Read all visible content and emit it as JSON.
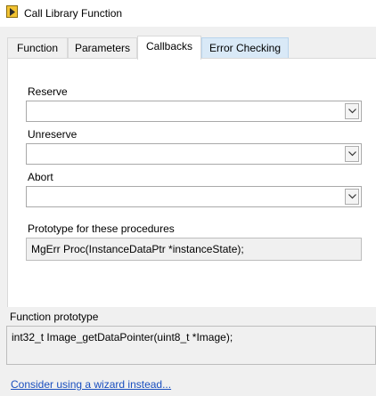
{
  "window": {
    "title": "Call Library Function",
    "icon": "labview-vi-icon"
  },
  "tabs": [
    {
      "label": "Function"
    },
    {
      "label": "Parameters"
    },
    {
      "label": "Callbacks",
      "active": true
    },
    {
      "label": "Error Checking",
      "hovered": true
    }
  ],
  "callbacks": {
    "reserve": {
      "label": "Reserve",
      "value": ""
    },
    "unreserve": {
      "label": "Unreserve",
      "value": ""
    },
    "abort": {
      "label": "Abort",
      "value": ""
    },
    "prototype_label": "Prototype for these procedures",
    "prototype_value": "MgErr Proc(InstanceDataPtr *instanceState);"
  },
  "function_prototype": {
    "label": "Function prototype",
    "value": "int32_t Image_getDataPointer(uint8_t *Image);"
  },
  "wizard_link": "Consider using a wizard instead...",
  "colors": {
    "link": "#1a4fbf",
    "hover_tab": "#d9e9f7",
    "active_tab": "#ffffff",
    "background": "#f0f0f0"
  }
}
